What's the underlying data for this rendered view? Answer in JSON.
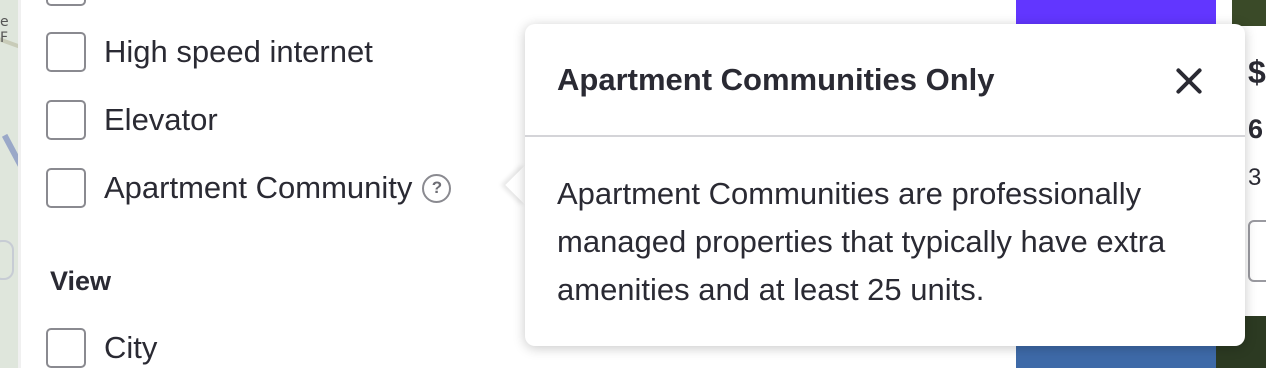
{
  "map": {
    "label": "e F"
  },
  "filters": {
    "amenities": [
      {
        "label": "High speed internet",
        "checked": false
      },
      {
        "label": "Elevator",
        "checked": false
      },
      {
        "label": "Apartment Community",
        "checked": false,
        "help_icon": "?"
      }
    ],
    "view_section": {
      "title": "View",
      "items": [
        {
          "label": "City",
          "checked": false
        }
      ]
    }
  },
  "popover": {
    "title": "Apartment Communities Only",
    "body": "Apartment Communities are professionally managed properties that typically have extra amenities and at least 25 units.",
    "close_icon": "close-icon"
  },
  "listing_partial": {
    "price_fragment": "$",
    "line1_fragment": "6",
    "line2_fragment": "3"
  },
  "colors": {
    "accent_purple": "#6236ff",
    "text": "#2a2a33",
    "checkbox_border": "#8a8a90"
  }
}
